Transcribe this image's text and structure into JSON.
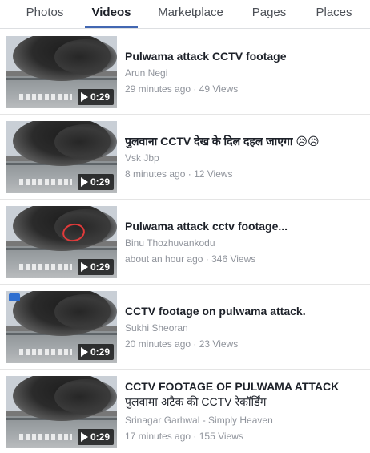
{
  "tabs": [
    {
      "label": "Photos",
      "active": false
    },
    {
      "label": "Videos",
      "active": true
    },
    {
      "label": "Marketplace",
      "active": false
    },
    {
      "label": "Pages",
      "active": false
    },
    {
      "label": "Places",
      "active": false
    }
  ],
  "videos": [
    {
      "title": "Pulwama attack CCTV footage",
      "author": "Arun Negi",
      "time": "29 minutes ago",
      "views": "49 Views",
      "duration": "0:29"
    },
    {
      "title": "पुलवाना CCTV देख के दिल दहल जाएगा 😥😥",
      "author": "Vsk Jbp",
      "time": "8 minutes ago",
      "views": "12 Views",
      "duration": "0:29"
    },
    {
      "title": "Pulwama attack cctv footage...",
      "author": "Binu Thozhuvankodu",
      "time": "about an hour ago",
      "views": "346 Views",
      "duration": "0:29"
    },
    {
      "title": "CCTV footage on pulwama attack.",
      "author": "Sukhi Sheoran",
      "time": "20 minutes ago",
      "views": "23 Views",
      "duration": "0:29"
    },
    {
      "title": "CCTV FOOTAGE OF PULWAMA ATTACK",
      "title_line2": "पुलवामा अटैक की CCTV रेकॉर्डिंग",
      "author": "Srinagar Garhwal - Simply Heaven",
      "time": "17 minutes ago",
      "views": "155 Views",
      "duration": "0:29"
    }
  ],
  "meta_separator": " · ",
  "colors": {
    "accent": "#4267b2",
    "text_primary": "#1d2129",
    "text_secondary": "#90949c",
    "divider": "#e5e5e5"
  }
}
